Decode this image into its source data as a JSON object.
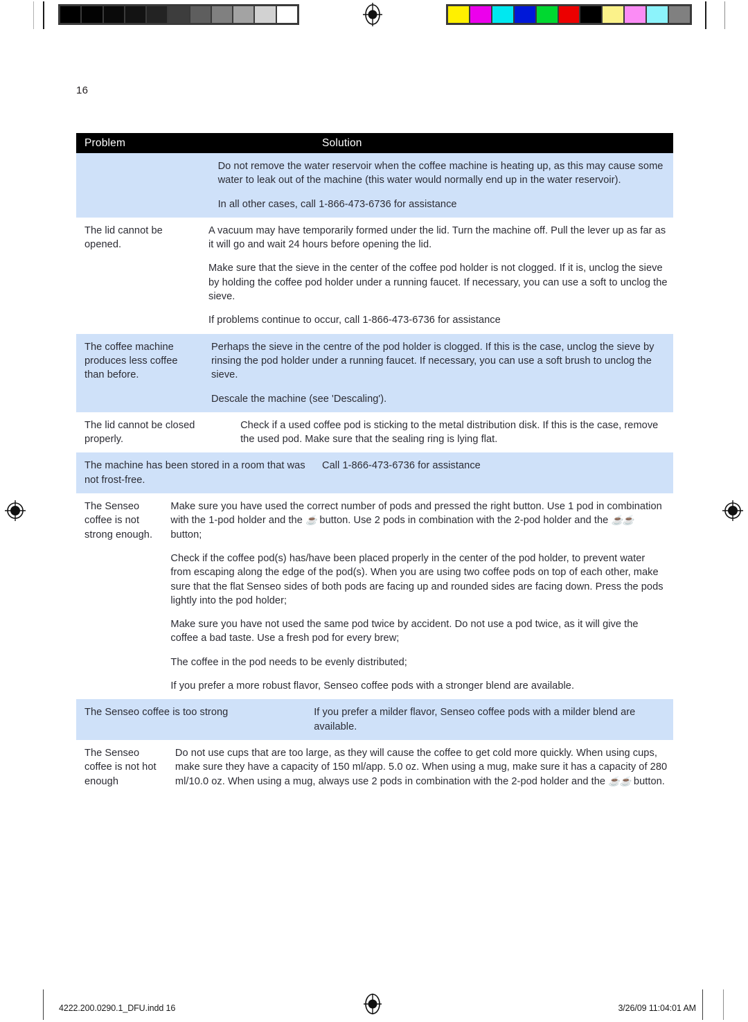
{
  "print_marks": {
    "grayscale_swatches": [
      "#000000",
      "#030303",
      "#0a0a0a",
      "#131313",
      "#232323",
      "#3d3d3d",
      "#5e5e5e",
      "#808080",
      "#a3a3a3",
      "#d2d2d2",
      "#ffffff"
    ],
    "color_swatches": [
      "#fff000",
      "#ec00ec",
      "#00e8f0",
      "#0018d8",
      "#00d830",
      "#ec0000",
      "#000000",
      "#fbf28a",
      "#fb8cf5",
      "#8cf3fb",
      "#808080"
    ],
    "registration_mark_name": "registration-target"
  },
  "page": {
    "number": "16"
  },
  "table": {
    "header": {
      "problem": "Problem",
      "solution": "Solution"
    },
    "shade_color": "#cfe1f9",
    "rows": [
      {
        "shaded": true,
        "problem": [],
        "solution": [
          "Do not remove the water reservoir when the coffee machine is heating up, as this may cause some water to leak out of the machine (this water would normally end up in the water reservoir).",
          "In all other cases, call 1-866-473-6736 for assistance"
        ]
      },
      {
        "shaded": false,
        "problem": [
          "The lid cannot be opened."
        ],
        "solution": [
          "A vacuum may have temporarily formed under the lid. Turn the machine off. Pull the lever up as far as it will go and wait 24 hours before opening the lid.",
          "Make sure that the sieve in the center of the coffee pod holder is not clogged. If it is, unclog the sieve by holding the coffee pod holder under a running faucet. If necessary, you can use a soft to unclog the sieve.",
          "If problems continue to occur,  call 1-866-473-6736 for assistance"
        ]
      },
      {
        "shaded": true,
        "problem": [
          "The coffee machine produces less coffee than before."
        ],
        "solution": [
          "Perhaps the sieve in the centre of the pod holder is clogged. If this is the case, unclog the sieve by rinsing the pod holder under a running faucet. If necessary, you can use a soft brush to unclog the sieve.",
          "Descale the machine (see 'Descaling')."
        ]
      },
      {
        "shaded": false,
        "problem": [
          "The lid cannot be closed properly."
        ],
        "solution": [
          "Check if a used coffee pod is sticking to the metal distribution disk. If this is the case, remove the used pod. Make sure that the sealing ring is lying flat."
        ]
      },
      {
        "shaded": true,
        "problem": [
          "The machine has been stored in a room that was not frost-free."
        ],
        "solution": [
          "Call 1-866-473-6736 for assistance"
        ]
      },
      {
        "shaded": false,
        "problem": [
          "The Senseo coffee is not strong enough."
        ],
        "solution_rich": [
          {
            "before": "Make sure you have used the correct number of pods and pressed the right button. Use 1 pod in combination with the 1-pod holder and the ",
            "icon1": "1",
            "middle": " button. Use 2 pods in combination with the 2-pod holder and the ",
            "icon2": "2",
            "after": " button;"
          }
        ],
        "solution": [
          "Check if the coffee pod(s) has/have been placed properly in the center of the pod holder, to prevent water from escaping along the edge of the pod(s). When you are using two coffee pods on top of each other, make sure that the flat Senseo sides of both pods are facing up and rounded sides are facing down. Press the pods lightly into the pod holder;",
          "Make sure you have not used the same pod twice by accident. Do not use a pod twice, as it will give the coffee a bad taste. Use a fresh pod for every brew;",
          "The coffee in the pod needs to be evenly distributed;",
          "If you prefer a more robust flavor, Senseo coffee pods with a stronger blend are available."
        ]
      },
      {
        "shaded": true,
        "problem": [
          "The Senseo coffee is too strong"
        ],
        "solution": [
          "If you prefer a milder flavor, Senseo coffee pods with a milder blend are available."
        ]
      },
      {
        "shaded": false,
        "problem": [
          "The Senseo coffee is not hot enough"
        ],
        "solution_rich_tail": {
          "before": "Do not use cups that are too large, as they will cause the coffee to get cold more quickly. When using cups, make sure they have a capacity of 150 ml/app. 5.0 oz. When using a mug, make sure it has a capacity of 280 ml/10.0 oz. When using a mug, always use 2 pods in combination with the 2-pod holder and the ",
          "after": " button."
        },
        "solution": []
      }
    ]
  },
  "footer": {
    "file_name": "4222.200.0290.1_DFU.indd   16",
    "timestamp": "3/26/09   11:04:01 AM"
  },
  "icons": {
    "coffee_cup": "☕",
    "coffee_cup_label": "coffee-cup-button-icon"
  }
}
